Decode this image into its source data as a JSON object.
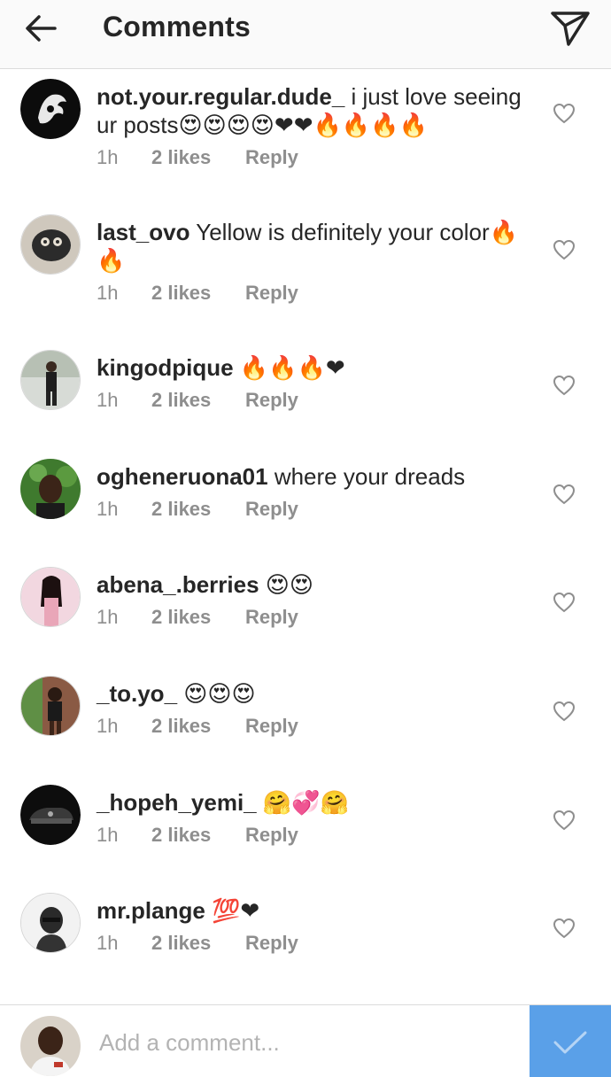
{
  "header": {
    "title": "Comments",
    "back_icon": "arrow-left-icon",
    "direct_icon": "paper-plane-icon"
  },
  "comments": [
    {
      "user": "not.your.regular.dude_",
      "text": " i just love seeing ur posts😍😍😍😍❤❤🔥🔥🔥🔥",
      "time": "1h",
      "likes": "2 likes",
      "reply": "Reply"
    },
    {
      "user": "last_ovo",
      "text": " Yellow is definitely your color🔥🔥",
      "time": "1h",
      "likes": "2 likes",
      "reply": "Reply"
    },
    {
      "user": "kingodpique",
      "text": " 🔥🔥🔥❤",
      "time": "1h",
      "likes": "2 likes",
      "reply": "Reply"
    },
    {
      "user": "ogheneruona01",
      "text": " where your dreads",
      "time": "1h",
      "likes": "2 likes",
      "reply": "Reply"
    },
    {
      "user": "abena_.berries",
      "text": " 😍😍",
      "time": "1h",
      "likes": "2 likes",
      "reply": "Reply"
    },
    {
      "user": "_to.yo_",
      "text": " 😍😍😍",
      "time": "1h",
      "likes": "2 likes",
      "reply": "Reply"
    },
    {
      "user": "_hopeh_yemi_",
      "text": " 🤗💞🤗",
      "time": "1h",
      "likes": "2 likes",
      "reply": "Reply"
    },
    {
      "user": "mr.plange",
      "text": " 💯❤",
      "time": "1h",
      "likes": "2 likes",
      "reply": "Reply"
    }
  ],
  "composer": {
    "placeholder": "Add a comment...",
    "post_icon": "checkmark-icon"
  },
  "colors": {
    "accent": "#5aa0e8",
    "meta": "#8e8e8e",
    "text": "#262626",
    "header_bg": "#fafafa"
  }
}
